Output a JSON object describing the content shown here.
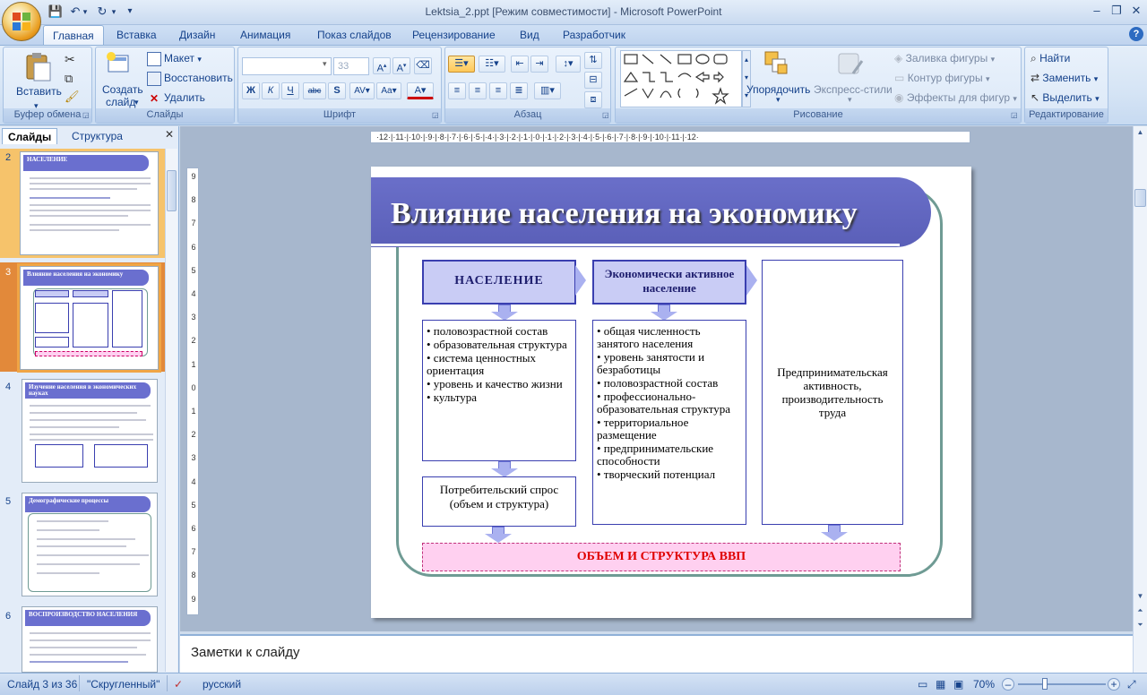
{
  "window": {
    "title": "Lektsia_2.ppt [Режим совместимости] - Microsoft PowerPoint"
  },
  "ribbon": {
    "tabs": [
      "Главная",
      "Вставка",
      "Дизайн",
      "Анимация",
      "Показ слайдов",
      "Рецензирование",
      "Вид",
      "Разработчик"
    ],
    "clipboard": {
      "paste": "Вставить",
      "label": "Буфер обмена"
    },
    "slides": {
      "create": "Создать",
      "create2": "слайд",
      "layout": "Макет",
      "reset": "Восстановить",
      "delete": "Удалить",
      "label": "Слайды"
    },
    "font": {
      "size": "33",
      "label": "Шрифт"
    },
    "paragraph": {
      "label": "Абзац"
    },
    "drawing": {
      "arrange": "Упорядочить",
      "express": "Экспресс-стили",
      "fill": "Заливка фигуры",
      "outline": "Контур фигуры",
      "effects": "Эффекты для фигур",
      "label": "Рисование"
    },
    "editing": {
      "find": "Найти",
      "replace": "Заменить",
      "select": "Выделить",
      "label": "Редактирование"
    }
  },
  "left_pane": {
    "tab_slides": "Слайды",
    "tab_outline": "Структура",
    "thumbnails": [
      {
        "num": "2",
        "title": "НАСЕЛЕНИЕ"
      },
      {
        "num": "3",
        "title": "Влияние населения на экономику"
      },
      {
        "num": "4",
        "title": "Изучение населения в экономических науках"
      },
      {
        "num": "5",
        "title": "Демографические процессы"
      },
      {
        "num": "6",
        "title": "ВОСПРОИЗВОДСТВО НАСЕЛЕНИЯ"
      }
    ]
  },
  "ruler": {
    "horizontal": "·12·|·11·|·10·|·9·|·8·|·7·|·6·|·5·|·4·|·3·|·2·|·1·|·0·|·1·|·2·|·3·|·4·|·5·|·6·|·7·|·8·|·9·|·10·|·11·|·12·",
    "vertical": [
      "9",
      "8",
      "7",
      "6",
      "5",
      "4",
      "3",
      "2",
      "1",
      "0",
      "1",
      "2",
      "3",
      "4",
      "5",
      "6",
      "7",
      "8",
      "9"
    ]
  },
  "slide": {
    "title": "Влияние населения на экономику",
    "col1_header": "НАСЕЛЕНИЕ",
    "col1_items": [
      "• половозрастной состав",
      "• образовательная структура",
      "• система ценностных ориентация",
      "• уровень и качество жизни",
      "• культура"
    ],
    "col1_bottom": "Потребительский спрос (объем и структура)",
    "col2_header": "Экономически активное население",
    "col2_items": [
      "• общая численность занятого населения",
      "• уровень занятости и безработицы",
      "• половозрастной состав",
      "• профессионально-образовательная структура",
      "• территориальное размещение",
      "• предпринимательские способности",
      "• творческий потенциал"
    ],
    "col3_text": "Предпринимательская активность, производительность труда",
    "bottom_bar": "ОБЪЕМ И СТРУКТУРА ВВП"
  },
  "notes": {
    "placeholder": "Заметки к слайду"
  },
  "status": {
    "slide_counter": "Слайд 3 из 36",
    "theme": "\"Скругленный\"",
    "language": "русский",
    "zoom": "70%"
  },
  "colors": {
    "banner": "#6a6fc9",
    "frame": "#6f9b94",
    "box_border": "#3a3fb0",
    "bar_fill": "#ffd0f0",
    "bar_text": "#e00000"
  }
}
